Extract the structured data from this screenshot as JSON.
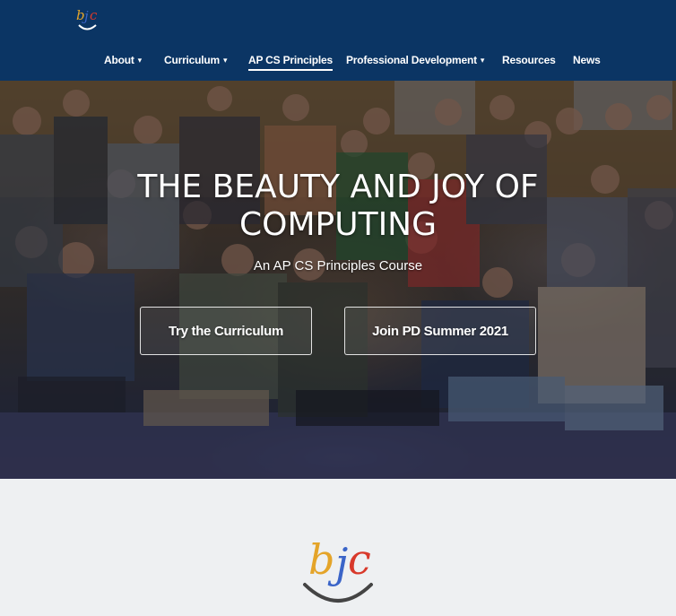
{
  "navbar": {
    "logo_text": "bjc",
    "items": [
      {
        "label": "About",
        "has_dropdown": true
      },
      {
        "label": "Curriculum",
        "has_dropdown": true
      },
      {
        "label": "AP CS Principles",
        "has_dropdown": false,
        "active": true
      },
      {
        "label": "Professional Development",
        "has_dropdown": true
      },
      {
        "label": "Resources",
        "has_dropdown": false
      },
      {
        "label": "News",
        "has_dropdown": false
      }
    ],
    "caret_glyph": "▾"
  },
  "hero": {
    "title_line1": "THE BEAUTY AND JOY OF",
    "title_line2": "COMPUTING",
    "subtitle": "An AP CS Principles Course",
    "buttons": {
      "try": "Try the Curriculum",
      "join": "Join PD Summer 2021"
    }
  },
  "bottom": {
    "logo_text": "bjc"
  },
  "colors": {
    "navbar_bg": "#0b3564",
    "logo_b": "#e4a429",
    "logo_j": "#3a64c8",
    "logo_c": "#d8392b",
    "page_bg": "#eef0f2"
  }
}
